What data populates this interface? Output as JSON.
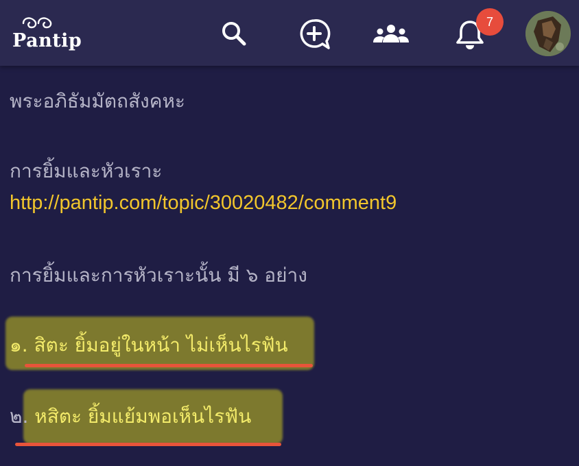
{
  "header": {
    "logo_text": "Pantip",
    "notification_count": "7",
    "accent_color": "#e74c3c",
    "icons": [
      "pantip-logo-icon",
      "search-icon",
      "new-topic-icon",
      "groups-icon",
      "bell-icon"
    ]
  },
  "content": {
    "line1": "พระอภิธัมมัตถสังคหะ",
    "line2": "การยิ้มและหัวเราะ",
    "link": "http://pantip.com/topic/30020482/comment9",
    "line4": "การยิ้มและการหัวเราะนั้น มี ๖ อย่าง",
    "item1": "๑. สิตะ ยิ้มอยู่ในหน้า ไม่เห็นไรฟัน",
    "item2_number": "๒.",
    "item2_text": "หสิตะ ยิ้มแย้มพอเห็นไรฟัน",
    "highlight_color": "#cbc41e",
    "underline_color": "#e8543a",
    "link_color": "#f2c62c"
  }
}
